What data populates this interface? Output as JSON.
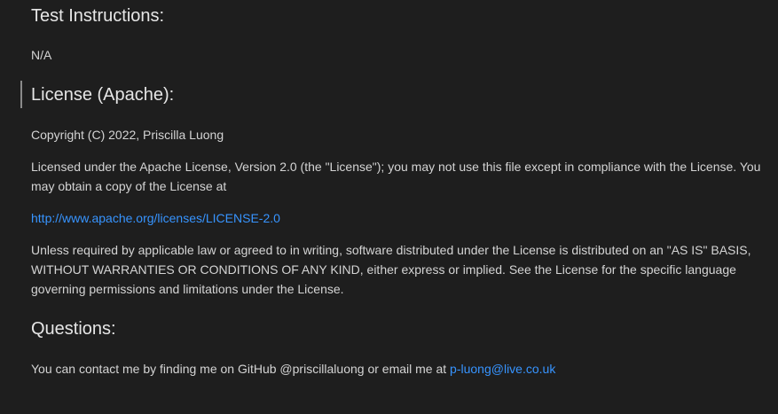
{
  "sections": {
    "test_instructions": {
      "heading": "Test Instructions:",
      "body": "N/A"
    },
    "license": {
      "heading": "License (Apache):",
      "copyright": "Copyright (C) 2022, Priscilla Luong",
      "paragraph1": "Licensed under the Apache License, Version 2.0 (the \"License\"); you may not use this file except in compliance with the License. You may obtain a copy of the License at",
      "link": "http://www.apache.org/licenses/LICENSE-2.0",
      "paragraph2": "Unless required by applicable law or agreed to in writing, software distributed under the License is distributed on an \"AS IS\" BASIS, WITHOUT WARRANTIES OR CONDITIONS OF ANY KIND, either express or implied. See the License for the specific language governing permissions and limitations under the License."
    },
    "questions": {
      "heading": "Questions:",
      "body_prefix": "You can contact me by finding me on GitHub @priscillaluong or email me at ",
      "email": "p-luong@live.co.uk"
    }
  },
  "colors": {
    "background": "#1e1e1e",
    "text": "#d4d4d4",
    "heading": "#e6e6e6",
    "link": "#3794ff",
    "active_bar": "#8a8a8a"
  }
}
